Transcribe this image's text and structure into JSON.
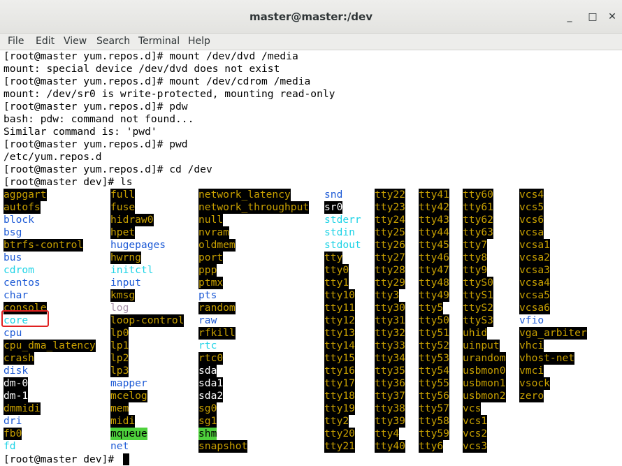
{
  "window": {
    "title": "master@master:/dev",
    "minimize_icon": "minimize-icon",
    "maximize_icon": "maximize-icon",
    "close_icon": "close-icon",
    "minimize_glyph": "_",
    "maximize_glyph": "□",
    "close_glyph": "✕"
  },
  "menu": [
    "File",
    "Edit",
    "View",
    "Search",
    "Terminal",
    "Help"
  ],
  "lines": [
    "[root@master yum.repos.d]# mount /dev/dvd /media",
    "mount: special device /dev/dvd does not exist",
    "[root@master yum.repos.d]# mount /dev/cdrom /media",
    "mount: /dev/sr0 is write-protected, mounting read-only",
    "[root@master yum.repos.d]# pdw",
    "bash: pdw: command not found...",
    "Similar command is: 'pwd'",
    "[root@master yum.repos.d]# pwd",
    "/etc/yum.repos.d",
    "[root@master yum.repos.d]# cd /dev",
    "[root@master dev]# ls"
  ],
  "ls_columns": [
    [
      {
        "t": "agpgart",
        "s": "y"
      },
      {
        "t": "autofs",
        "s": "y"
      },
      {
        "t": "block",
        "s": "b"
      },
      {
        "t": "bsg",
        "s": "b"
      },
      {
        "t": "btrfs-control",
        "s": "y"
      },
      {
        "t": "bus",
        "s": "b"
      },
      {
        "t": "cdrom",
        "s": "c"
      },
      {
        "t": "centos",
        "s": "b"
      },
      {
        "t": "char",
        "s": "b"
      },
      {
        "t": "console",
        "s": "y"
      },
      {
        "t": "core",
        "s": "c"
      },
      {
        "t": "cpu",
        "s": "b"
      },
      {
        "t": "cpu_dma_latency",
        "s": "y"
      },
      {
        "t": "crash",
        "s": "y"
      },
      {
        "t": "disk",
        "s": "b"
      },
      {
        "t": "dm-0",
        "s": "w"
      },
      {
        "t": "dm-1",
        "s": "w"
      },
      {
        "t": "dmmidi",
        "s": "y"
      },
      {
        "t": "dri",
        "s": "b"
      },
      {
        "t": "fb0",
        "s": "y"
      },
      {
        "t": "fd",
        "s": "c"
      }
    ],
    [
      {
        "t": "full",
        "s": "y"
      },
      {
        "t": "fuse",
        "s": "y"
      },
      {
        "t": "hidraw0",
        "s": "y"
      },
      {
        "t": "hpet",
        "s": "y"
      },
      {
        "t": "hugepages",
        "s": "b"
      },
      {
        "t": "hwrng",
        "s": "y"
      },
      {
        "t": "initctl",
        "s": "c"
      },
      {
        "t": "input",
        "s": "b"
      },
      {
        "t": "kmsg",
        "s": "y"
      },
      {
        "t": "log",
        "s": "g"
      },
      {
        "t": "loop-control",
        "s": "y"
      },
      {
        "t": "lp0",
        "s": "y"
      },
      {
        "t": "lp1",
        "s": "y"
      },
      {
        "t": "lp2",
        "s": "y"
      },
      {
        "t": "lp3",
        "s": "y"
      },
      {
        "t": "mapper",
        "s": "b"
      },
      {
        "t": "mcelog",
        "s": "y"
      },
      {
        "t": "mem",
        "s": "y"
      },
      {
        "t": "midi",
        "s": "y"
      },
      {
        "t": "mqueue",
        "s": "gr"
      },
      {
        "t": "net",
        "s": "b"
      }
    ],
    [
      {
        "t": "network_latency",
        "s": "y"
      },
      {
        "t": "network_throughput",
        "s": "y"
      },
      {
        "t": "null",
        "s": "y"
      },
      {
        "t": "nvram",
        "s": "y"
      },
      {
        "t": "oldmem",
        "s": "y"
      },
      {
        "t": "port",
        "s": "y"
      },
      {
        "t": "ppp",
        "s": "y"
      },
      {
        "t": "ptmx",
        "s": "y"
      },
      {
        "t": "pts",
        "s": "b"
      },
      {
        "t": "random",
        "s": "y"
      },
      {
        "t": "raw",
        "s": "b"
      },
      {
        "t": "rfkill",
        "s": "y"
      },
      {
        "t": "rtc",
        "s": "c"
      },
      {
        "t": "rtc0",
        "s": "y"
      },
      {
        "t": "sda",
        "s": "w"
      },
      {
        "t": "sda1",
        "s": "w"
      },
      {
        "t": "sda2",
        "s": "w"
      },
      {
        "t": "sg0",
        "s": "y"
      },
      {
        "t": "sg1",
        "s": "y"
      },
      {
        "t": "shm",
        "s": "gr"
      },
      {
        "t": "snapshot",
        "s": "y"
      }
    ],
    [
      {
        "t": "snd",
        "s": "b"
      },
      {
        "t": "sr0",
        "s": "w"
      },
      {
        "t": "stderr",
        "s": "c"
      },
      {
        "t": "stdin",
        "s": "c"
      },
      {
        "t": "stdout",
        "s": "c"
      },
      {
        "t": "tty",
        "s": "y"
      },
      {
        "t": "tty0",
        "s": "y"
      },
      {
        "t": "tty1",
        "s": "y"
      },
      {
        "t": "tty10",
        "s": "y"
      },
      {
        "t": "tty11",
        "s": "y"
      },
      {
        "t": "tty12",
        "s": "y"
      },
      {
        "t": "tty13",
        "s": "y"
      },
      {
        "t": "tty14",
        "s": "y"
      },
      {
        "t": "tty15",
        "s": "y"
      },
      {
        "t": "tty16",
        "s": "y"
      },
      {
        "t": "tty17",
        "s": "y"
      },
      {
        "t": "tty18",
        "s": "y"
      },
      {
        "t": "tty19",
        "s": "y"
      },
      {
        "t": "tty2",
        "s": "y"
      },
      {
        "t": "tty20",
        "s": "y"
      },
      {
        "t": "tty21",
        "s": "y"
      }
    ],
    [
      {
        "t": "tty22",
        "s": "y"
      },
      {
        "t": "tty23",
        "s": "y"
      },
      {
        "t": "tty24",
        "s": "y"
      },
      {
        "t": "tty25",
        "s": "y"
      },
      {
        "t": "tty26",
        "s": "y"
      },
      {
        "t": "tty27",
        "s": "y"
      },
      {
        "t": "tty28",
        "s": "y"
      },
      {
        "t": "tty29",
        "s": "y"
      },
      {
        "t": "tty3",
        "s": "y"
      },
      {
        "t": "tty30",
        "s": "y"
      },
      {
        "t": "tty31",
        "s": "y"
      },
      {
        "t": "tty32",
        "s": "y"
      },
      {
        "t": "tty33",
        "s": "y"
      },
      {
        "t": "tty34",
        "s": "y"
      },
      {
        "t": "tty35",
        "s": "y"
      },
      {
        "t": "tty36",
        "s": "y"
      },
      {
        "t": "tty37",
        "s": "y"
      },
      {
        "t": "tty38",
        "s": "y"
      },
      {
        "t": "tty39",
        "s": "y"
      },
      {
        "t": "tty4",
        "s": "y"
      },
      {
        "t": "tty40",
        "s": "y"
      }
    ],
    [
      {
        "t": "tty41",
        "s": "y"
      },
      {
        "t": "tty42",
        "s": "y"
      },
      {
        "t": "tty43",
        "s": "y"
      },
      {
        "t": "tty44",
        "s": "y"
      },
      {
        "t": "tty45",
        "s": "y"
      },
      {
        "t": "tty46",
        "s": "y"
      },
      {
        "t": "tty47",
        "s": "y"
      },
      {
        "t": "tty48",
        "s": "y"
      },
      {
        "t": "tty49",
        "s": "y"
      },
      {
        "t": "tty5",
        "s": "y"
      },
      {
        "t": "tty50",
        "s": "y"
      },
      {
        "t": "tty51",
        "s": "y"
      },
      {
        "t": "tty52",
        "s": "y"
      },
      {
        "t": "tty53",
        "s": "y"
      },
      {
        "t": "tty54",
        "s": "y"
      },
      {
        "t": "tty55",
        "s": "y"
      },
      {
        "t": "tty56",
        "s": "y"
      },
      {
        "t": "tty57",
        "s": "y"
      },
      {
        "t": "tty58",
        "s": "y"
      },
      {
        "t": "tty59",
        "s": "y"
      },
      {
        "t": "tty6",
        "s": "y"
      }
    ],
    [
      {
        "t": "tty60",
        "s": "y"
      },
      {
        "t": "tty61",
        "s": "y"
      },
      {
        "t": "tty62",
        "s": "y"
      },
      {
        "t": "tty63",
        "s": "y"
      },
      {
        "t": "tty7",
        "s": "y"
      },
      {
        "t": "tty8",
        "s": "y"
      },
      {
        "t": "tty9",
        "s": "y"
      },
      {
        "t": "ttyS0",
        "s": "y"
      },
      {
        "t": "ttyS1",
        "s": "y"
      },
      {
        "t": "ttyS2",
        "s": "y"
      },
      {
        "t": "ttyS3",
        "s": "y"
      },
      {
        "t": "uhid",
        "s": "y"
      },
      {
        "t": "uinput",
        "s": "y"
      },
      {
        "t": "urandom",
        "s": "y"
      },
      {
        "t": "usbmon0",
        "s": "y"
      },
      {
        "t": "usbmon1",
        "s": "y"
      },
      {
        "t": "usbmon2",
        "s": "y"
      },
      {
        "t": "vcs",
        "s": "y"
      },
      {
        "t": "vcs1",
        "s": "y"
      },
      {
        "t": "vcs2",
        "s": "y"
      },
      {
        "t": "vcs3",
        "s": "y"
      }
    ],
    [
      {
        "t": "vcs4",
        "s": "y"
      },
      {
        "t": "vcs5",
        "s": "y"
      },
      {
        "t": "vcs6",
        "s": "y"
      },
      {
        "t": "vcsa",
        "s": "y"
      },
      {
        "t": "vcsa1",
        "s": "y"
      },
      {
        "t": "vcsa2",
        "s": "y"
      },
      {
        "t": "vcsa3",
        "s": "y"
      },
      {
        "t": "vcsa4",
        "s": "y"
      },
      {
        "t": "vcsa5",
        "s": "y"
      },
      {
        "t": "vcsa6",
        "s": "y"
      },
      {
        "t": "vfio",
        "s": "b"
      },
      {
        "t": "vga_arbiter",
        "s": "y"
      },
      {
        "t": "vhci",
        "s": "y"
      },
      {
        "t": "vhost-net",
        "s": "y"
      },
      {
        "t": "vmci",
        "s": "y"
      },
      {
        "t": "vsock",
        "s": "y"
      },
      {
        "t": "zero",
        "s": "y"
      }
    ]
  ],
  "prompt_final": "[root@master dev]# ",
  "colors": {
    "dir": "#1e5bd6",
    "link": "#1ed3e6",
    "device": "#c8a000",
    "device_bg": "#000000",
    "socket": "#a58fa8",
    "sticky_bg": "#4ed13c",
    "highlight_box": "#e02020"
  }
}
